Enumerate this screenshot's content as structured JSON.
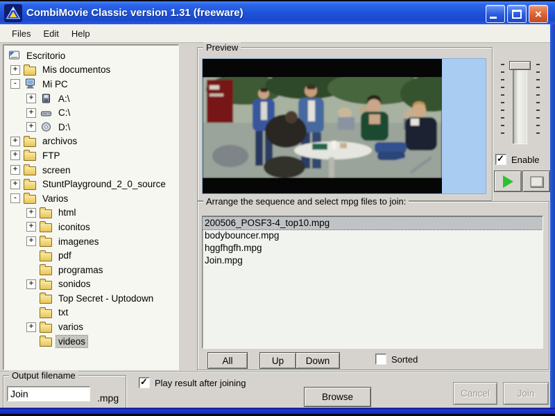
{
  "window": {
    "title": "CombiMovie Classic version 1.31 (freeware)"
  },
  "menu": {
    "items": [
      "Files",
      "Edit",
      "Help"
    ]
  },
  "tree": {
    "items": [
      {
        "label": "Escritorio",
        "exp": ""
      },
      {
        "label": "Mis documentos",
        "exp": "+"
      },
      {
        "label": "Mi PC",
        "exp": "-"
      },
      {
        "label": "A:\\",
        "exp": "+"
      },
      {
        "label": "C:\\",
        "exp": "+"
      },
      {
        "label": "D:\\",
        "exp": "+"
      },
      {
        "label": "archivos",
        "exp": "+"
      },
      {
        "label": "FTP",
        "exp": "+"
      },
      {
        "label": "screen",
        "exp": "+"
      },
      {
        "label": "StuntPlayground_2_0_source",
        "exp": "+"
      },
      {
        "label": "Varios",
        "exp": "-"
      },
      {
        "label": "html",
        "exp": "+"
      },
      {
        "label": "iconitos",
        "exp": "+"
      },
      {
        "label": "imagenes",
        "exp": "+"
      },
      {
        "label": "pdf",
        "exp": ""
      },
      {
        "label": "programas",
        "exp": ""
      },
      {
        "label": "sonidos",
        "exp": "+"
      },
      {
        "label": "Top Secret - Uptodown",
        "exp": ""
      },
      {
        "label": "txt",
        "exp": ""
      },
      {
        "label": "varios",
        "exp": "+"
      },
      {
        "label": "videos",
        "exp": "",
        "selected": true
      }
    ]
  },
  "preview": {
    "label": "Preview",
    "enable_label": "Enable",
    "enable_checked": true
  },
  "arrange": {
    "label": "Arrange the sequence and select mpg files to join:",
    "files": [
      "200506_POSF3-4_top10.mpg",
      "bodybouncer.mpg",
      "hggfhgfh.mpg",
      "Join.mpg"
    ],
    "selected_index": 0,
    "all_label": "All",
    "up_label": "Up",
    "down_label": "Down",
    "sorted_label": "Sorted",
    "sorted_checked": false
  },
  "output": {
    "label": "Output filename",
    "filename": "Join",
    "extension": ".mpg"
  },
  "options": {
    "play_after_label": "Play result after joining",
    "play_after_checked": true
  },
  "actions": {
    "browse": "Browse",
    "cancel": "Cancel",
    "join": "Join",
    "cancel_enabled": false,
    "join_enabled": false
  },
  "colors": {
    "titlebar_blue": "#2054dc",
    "dialog_gray": "#d6d3ce",
    "preview_bg": "#a9cdf2",
    "selection_gray": "#bfc3c6",
    "close_button": "#dd6035",
    "play_green": "#2fc02f"
  }
}
